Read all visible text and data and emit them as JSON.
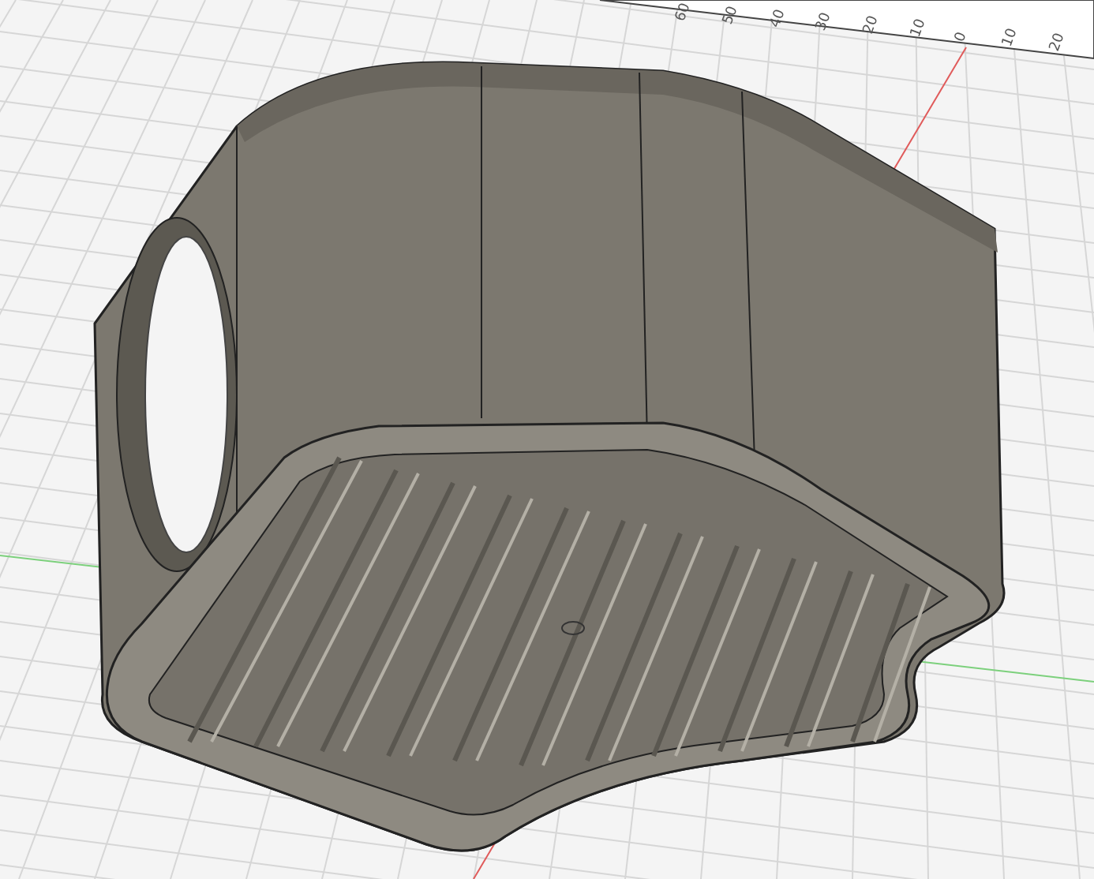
{
  "viewport": {
    "ruler_labels": [
      "60",
      "50",
      "40",
      "30",
      "20",
      "10",
      "0",
      "10",
      "20"
    ]
  }
}
